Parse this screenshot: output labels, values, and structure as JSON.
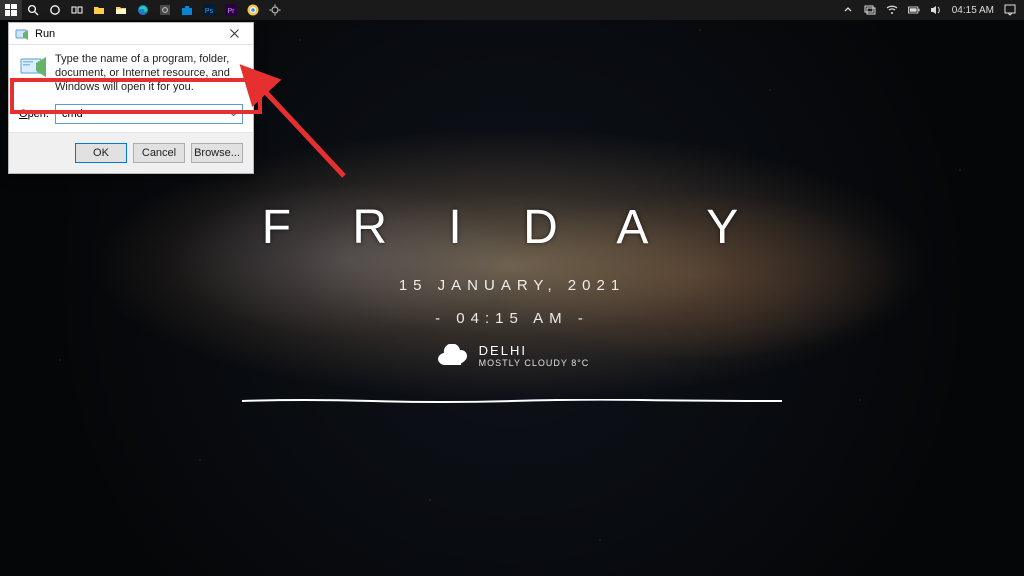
{
  "taskbar": {
    "tray": {
      "clock": "04:15 AM"
    }
  },
  "wallpaper": {
    "day": "F R I D A Y",
    "date": "15  JANUARY,  2021",
    "time": "- 04:15 AM -",
    "weather": {
      "location": "DELHI",
      "condition": "MOSTLY CLOUDY 8°C"
    }
  },
  "run_dialog": {
    "title": "Run",
    "description": "Type the name of a program, folder, document, or Internet resource, and Windows will open it for you.",
    "open_label_char": "O",
    "open_label_rest": "pen:",
    "input_value": "cmd",
    "buttons": {
      "ok": "OK",
      "cancel": "Cancel",
      "browse": "Browse..."
    }
  }
}
